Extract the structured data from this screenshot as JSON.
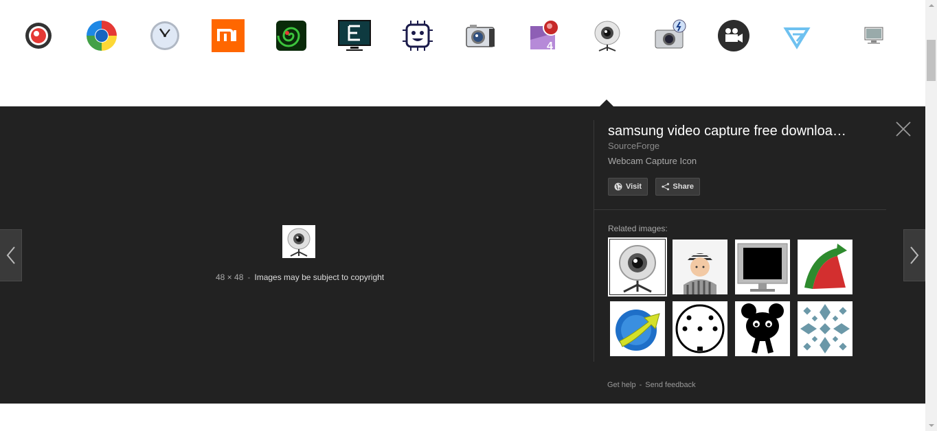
{
  "thumbnails": [
    {
      "icon": "red-record-circle-icon"
    },
    {
      "icon": "colorful-ring-icon"
    },
    {
      "icon": "clock-icon"
    },
    {
      "icon": "mi-logo-icon",
      "text": "mi"
    },
    {
      "icon": "green-swirl-icon"
    },
    {
      "icon": "monitor-e-icon"
    },
    {
      "icon": "robot-chip-icon"
    },
    {
      "icon": "camera-icon"
    },
    {
      "icon": "record-4-icon",
      "text": "4"
    },
    {
      "icon": "webcam-icon"
    },
    {
      "icon": "camera-flash-icon"
    },
    {
      "icon": "video-camera-icon"
    },
    {
      "icon": "diamond-logo-icon"
    },
    {
      "icon": "computer-monitor-icon"
    }
  ],
  "viewer": {
    "title": "samsung video capture free downloa…",
    "source": "SourceForge",
    "description": "Webcam Capture Icon",
    "visit_label": "Visit",
    "share_label": "Share",
    "image_size": "48 × 48",
    "separator": "-",
    "copyright_text": "Images may be subject to copyright",
    "related_label": "Related images:",
    "related": [
      {
        "icon": "webcam-thumb-icon"
      },
      {
        "icon": "prisoner-thumb-icon"
      },
      {
        "icon": "black-screen-thumb-icon"
      },
      {
        "icon": "pie-chart-arrow-thumb-icon"
      },
      {
        "icon": "globe-arrow-thumb-icon"
      },
      {
        "icon": "din-connector-thumb-icon"
      },
      {
        "icon": "black-creature-thumb-icon"
      },
      {
        "icon": "pattern-tile-thumb-icon"
      }
    ],
    "footer": {
      "help": "Get help",
      "separator": "-",
      "feedback": "Send feedback"
    }
  },
  "colors": {
    "panel_bg": "#222222",
    "title": "#ffffff",
    "muted": "#8c8c8c"
  }
}
